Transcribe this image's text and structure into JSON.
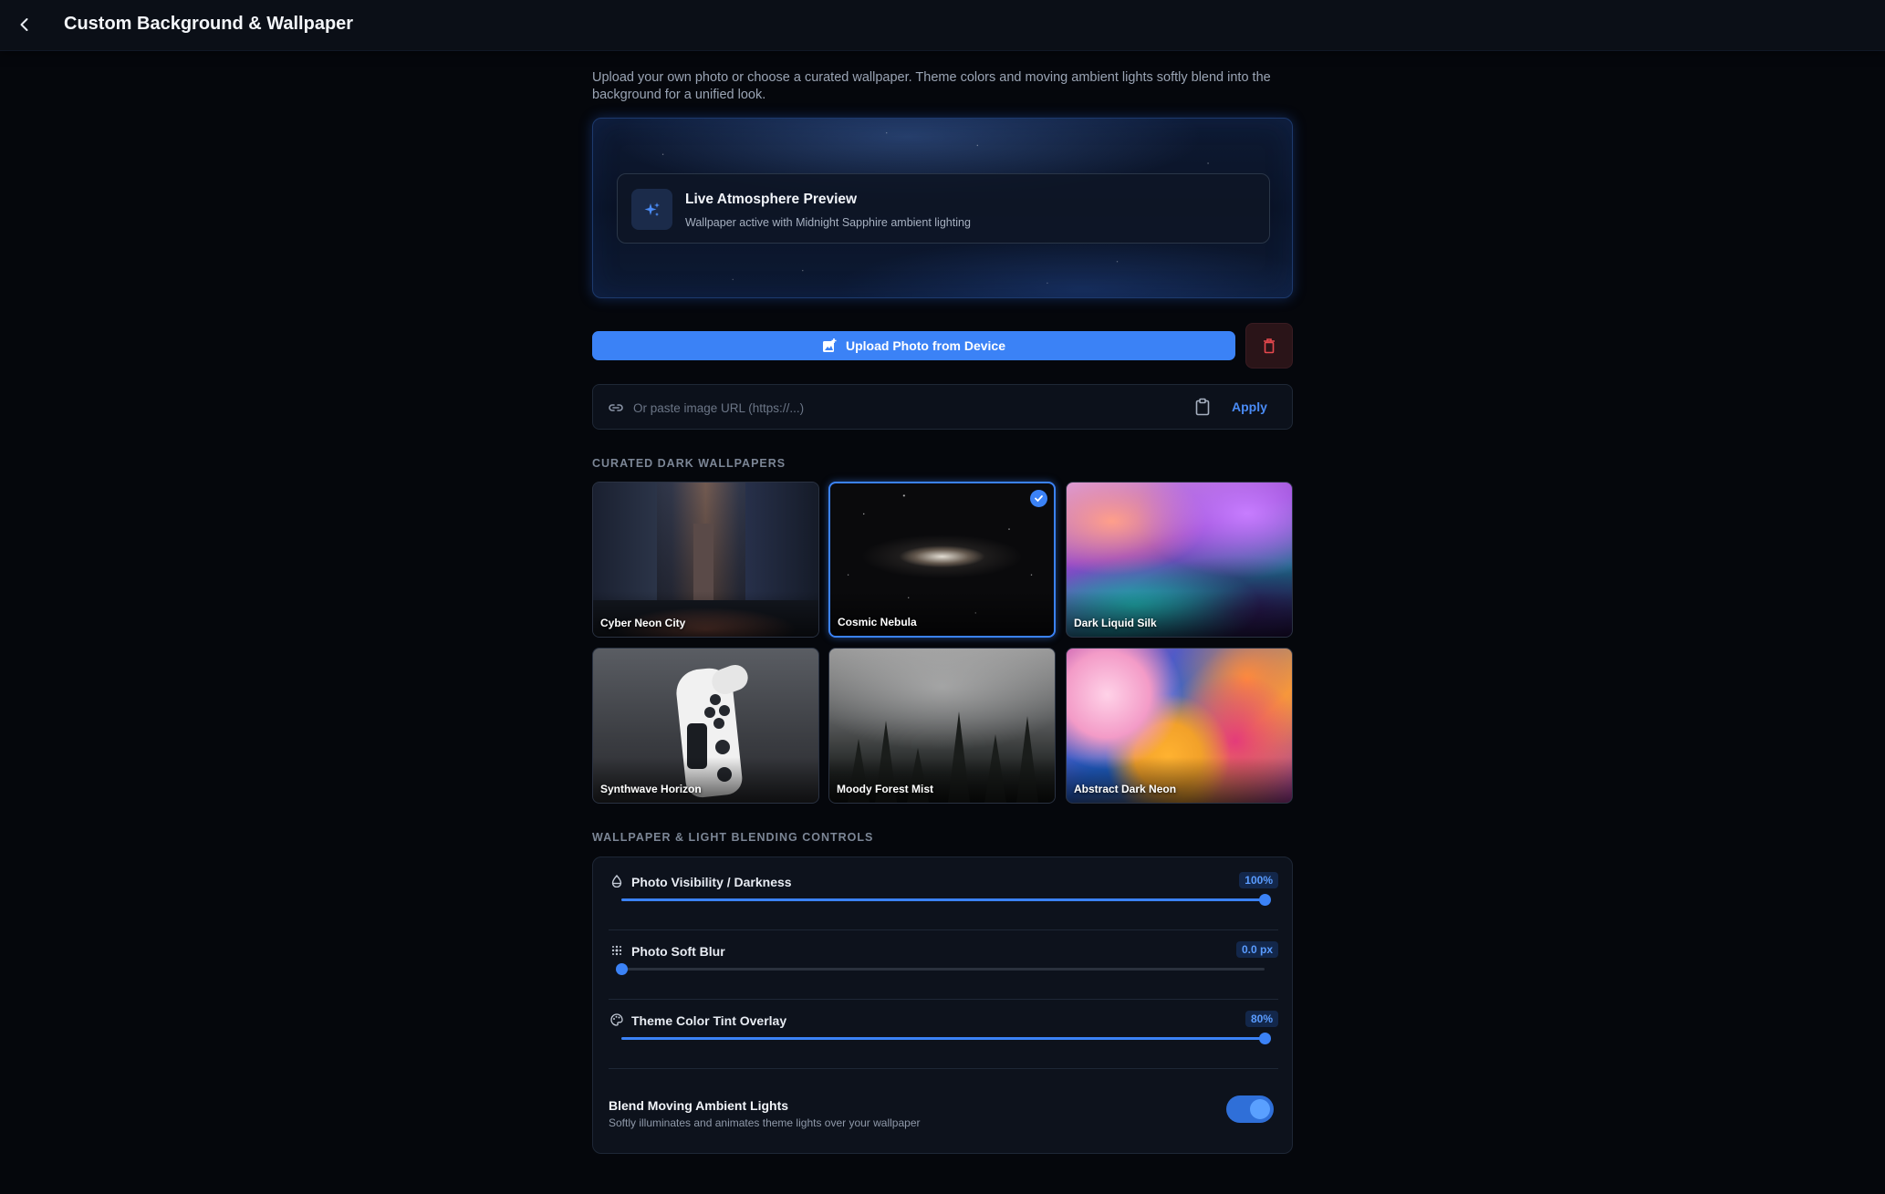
{
  "header": {
    "title": "Custom Background & Wallpaper",
    "back_icon": "chevron-left-icon"
  },
  "description": "Upload your own photo or choose a curated wallpaper. Theme colors and moving ambient lights softly blend into the background for a unified look.",
  "preview": {
    "title": "Live Atmosphere Preview",
    "subtitle": "Wallpaper active with Midnight Sapphire ambient lighting",
    "icon": "sparkles-icon"
  },
  "actions": {
    "upload_label": "Upload Photo from Device",
    "upload_icon": "add-photo-icon",
    "delete_icon": "trash-icon"
  },
  "url_input": {
    "placeholder": "Or paste image URL (https://...)",
    "value": "",
    "apply_label": "Apply",
    "link_icon": "link-icon",
    "clipboard_icon": "clipboard-icon"
  },
  "wallpapers": {
    "heading": "CURATED DARK WALLPAPERS",
    "selected": "Cosmic Nebula",
    "items": [
      {
        "label": "Cyber Neon City"
      },
      {
        "label": "Cosmic Nebula"
      },
      {
        "label": "Dark Liquid Silk"
      },
      {
        "label": "Synthwave Horizon"
      },
      {
        "label": "Moody Forest Mist"
      },
      {
        "label": "Abstract Dark Neon"
      }
    ]
  },
  "controls": {
    "heading": "WALLPAPER & LIGHT BLENDING CONTROLS",
    "sliders": [
      {
        "label": "Photo Visibility / Darkness",
        "value_text": "100%",
        "level": 1.0,
        "icon": "drop-icon"
      },
      {
        "label": "Photo Soft Blur",
        "value_text": "0.0 px",
        "level": 0.0,
        "icon": "blur-icon"
      },
      {
        "label": "Theme Color Tint Overlay",
        "value_text": "80%",
        "level": 1.0,
        "icon": "palette-icon"
      }
    ],
    "ambient": {
      "title": "Blend Moving Ambient Lights",
      "subtitle": "Softly illuminates and animates theme lights over your wallpaper",
      "enabled": true
    }
  },
  "colors": {
    "accent": "#3b82f6",
    "background": "#05070c",
    "danger": "#e5484d"
  }
}
